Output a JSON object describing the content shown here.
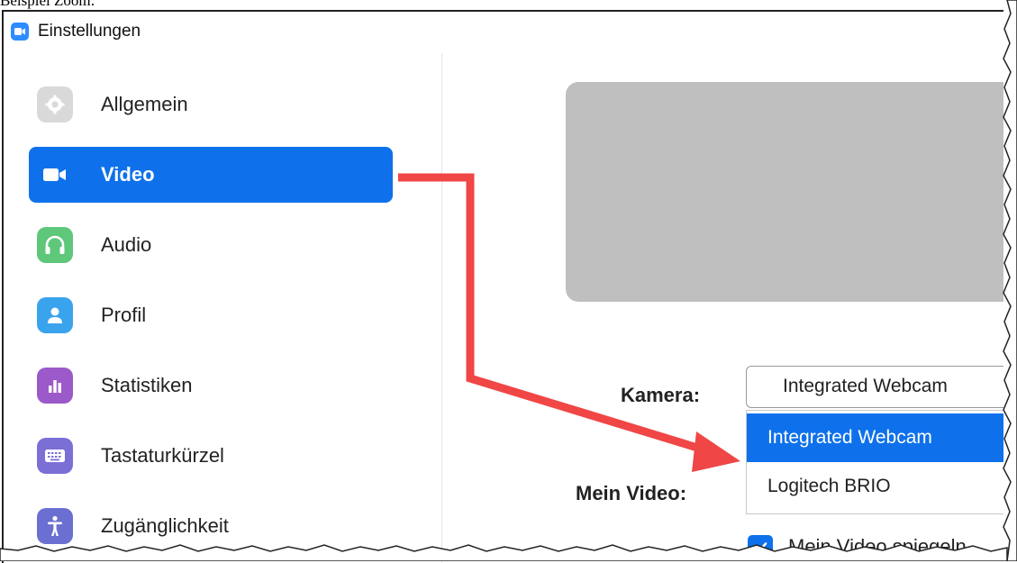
{
  "caption": "Beispiel Zoom:",
  "window": {
    "title": "Einstellungen"
  },
  "sidebar": {
    "items": [
      {
        "label": "Allgemein",
        "icon": "gear-icon",
        "color": "#d9d9d9"
      },
      {
        "label": "Video",
        "icon": "video-camera-icon",
        "color": "#0e71eb",
        "active": true
      },
      {
        "label": "Audio",
        "icon": "headphones-icon",
        "color": "#5ec77a"
      },
      {
        "label": "Profil",
        "icon": "person-icon",
        "color": "#3aa3ee"
      },
      {
        "label": "Statistiken",
        "icon": "bar-chart-icon",
        "color": "#9b59c9"
      },
      {
        "label": "Tastaturkürzel",
        "icon": "keyboard-icon",
        "color": "#7b6fd6"
      },
      {
        "label": "Zugänglichkeit",
        "icon": "accessibility-icon",
        "color": "#6a6fd1"
      }
    ]
  },
  "video": {
    "camera_label": "Kamera:",
    "camera_selected": "Integrated Webcam",
    "camera_options": [
      "Integrated Webcam",
      "Logitech BRIO"
    ],
    "my_video_label": "Mein Video:",
    "mirror_label": "Mein Video spiegeln"
  },
  "colors": {
    "accent": "#0e71eb",
    "arrow": "#f04646",
    "preview": "#bfbfbf"
  }
}
